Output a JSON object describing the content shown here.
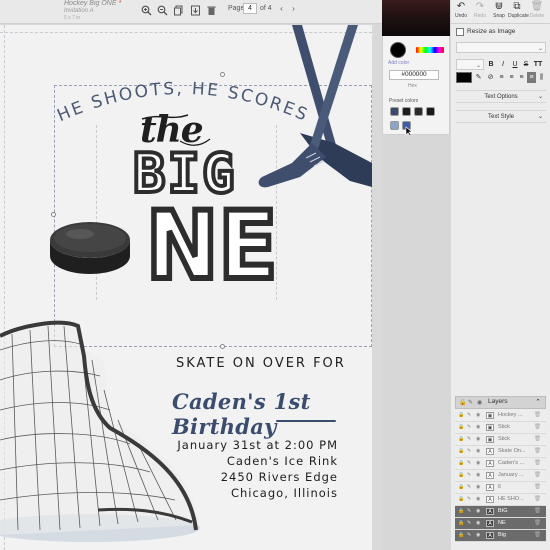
{
  "document": {
    "title": "Hockey Big ONE",
    "subtitle": "Invitation A",
    "size": "5 x 7 in"
  },
  "toolbar": {
    "icons": [
      "zoom-in-icon",
      "zoom-out-icon",
      "copy-icon",
      "download-icon",
      "delete-icon"
    ],
    "page_label": "Page",
    "page_value": "4",
    "page_of": "of 4"
  },
  "card": {
    "arc_text": "HE SHOOTS, HE SCORES",
    "the": "the",
    "big": "BIG",
    "one": "NE",
    "skate": "SKATE ON OVER  FOR",
    "name": "Caden's 1st Birthday",
    "details": [
      "January 31st at 2:00  PM",
      "Caden's Ice Rink",
      "2450 Rivers Edge",
      "Chicago, Illinois"
    ]
  },
  "color_picker": {
    "add_color": "Add color",
    "hex_value": "#000000",
    "hex_label": "Hex",
    "preset_label": "Preset colors",
    "presets_row1": [
      "#3a4a68",
      "#1d1d1d",
      "#2b2b2b",
      "#1a1a1a"
    ],
    "presets_row2": [
      "#8aa6c8",
      "#3e5aa8"
    ],
    "accent": "#000000"
  },
  "right_toolbar": {
    "items": [
      {
        "label": "Undo",
        "icon": "undo-icon"
      },
      {
        "label": "Redo",
        "icon": "redo-icon"
      },
      {
        "label": "Snap",
        "icon": "magnet-icon"
      },
      {
        "label": "Duplicate",
        "icon": "duplicate-icon"
      },
      {
        "label": "Delete",
        "icon": "trash-icon"
      }
    ]
  },
  "properties": {
    "resize_label": "Resize as Image",
    "format_buttons": [
      "B",
      "I",
      "U",
      "S",
      "TT"
    ],
    "text_options": "Text Options",
    "text_style": "Text Style"
  },
  "layers": {
    "title": "Layers",
    "items": [
      "Hockey ...",
      "Stick",
      "Stick",
      "Skate On...",
      "Caden's ...",
      "January ...",
      "6",
      "HE SHO...",
      "BIG",
      "NE",
      "Big"
    ]
  }
}
